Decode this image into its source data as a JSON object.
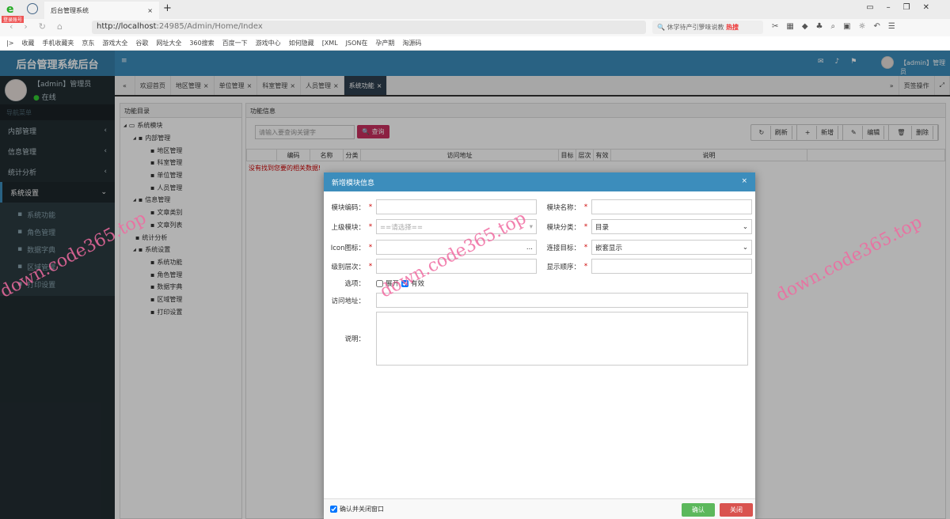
{
  "browser": {
    "tab_title": "后台管理系统",
    "badge": "登录账号",
    "url_host": "http://localhost",
    "url_rest": ":24985/Admin/Home/Index",
    "search_hint": "休学待产引箩味说教",
    "search_hot": "热搜",
    "bookmarks": [
      "收藏",
      "手机收藏夹",
      "京东",
      "游戏大全",
      "谷歌",
      "网址大全",
      "360搜索",
      "百度一下",
      "游戏中心",
      "如何隐藏",
      "[XML",
      "JSON在",
      "孕产期",
      "淘源码"
    ]
  },
  "app": {
    "logo": "后台管理系统后台",
    "header_user": "【admin】管理员",
    "user": {
      "name": "【admin】管理员",
      "status": "在线"
    },
    "nav_header": "导航菜单",
    "nav": [
      {
        "label": "内部管理"
      },
      {
        "label": "信息管理"
      },
      {
        "label": "统计分析"
      },
      {
        "label": "系统设置"
      }
    ],
    "sub_nav": [
      "系统功能",
      "角色管理",
      "数据字典",
      "区域管理",
      "打印设置"
    ],
    "tabs": [
      "欢迎首页",
      "地区管理",
      "单位管理",
      "科室管理",
      "人员管理",
      "系统功能"
    ],
    "tab_ops": "页签操作",
    "tree_title": "功能目录",
    "tree": [
      {
        "label": "系统模块",
        "lvl": 0
      },
      {
        "label": "内部管理",
        "lvl": 1
      },
      {
        "label": "地区管理",
        "lvl": 2
      },
      {
        "label": "科室管理",
        "lvl": 2
      },
      {
        "label": "单位管理",
        "lvl": 2
      },
      {
        "label": "人员管理",
        "lvl": 2
      },
      {
        "label": "信息管理",
        "lvl": 1
      },
      {
        "label": "文章类别",
        "lvl": 2
      },
      {
        "label": "文章列表",
        "lvl": 2
      },
      {
        "label": "统计分析",
        "lvl": 1
      },
      {
        "label": "系统设置",
        "lvl": 1
      },
      {
        "label": "系统功能",
        "lvl": 2
      },
      {
        "label": "角色管理",
        "lvl": 2
      },
      {
        "label": "数据字典",
        "lvl": 2
      },
      {
        "label": "区域管理",
        "lvl": 2
      },
      {
        "label": "打印设置",
        "lvl": 2
      }
    ],
    "panel_title": "功能信息",
    "search_placeholder": "请输入要查询关键字",
    "search_btn": "查询",
    "toolbar": [
      "刷新",
      "新增",
      "编辑",
      "删除"
    ],
    "columns": [
      "编码",
      "名称",
      "分类",
      "访问地址",
      "目标",
      "层次",
      "有效",
      "说明"
    ],
    "empty": "没有找到您要的相关数据!"
  },
  "modal": {
    "title": "新增模块信息",
    "code_label": "模块编码：",
    "name_label": "模块名称：",
    "parent_label": "上级模块：",
    "parent_placeholder": "==请选择==",
    "type_label": "模块分类：",
    "type_value": "目录",
    "icon_label": "Icon图标：",
    "icon_btn": "...",
    "target_label": "连接目标：",
    "target_value": "嵌套显示",
    "level_label": "级别层次：",
    "order_label": "显示顺序：",
    "options_label": "选项：",
    "opt_expand": "展开",
    "opt_expand_checked": false,
    "opt_valid": "有效",
    "opt_valid_checked": true,
    "url_label": "访问地址：",
    "desc_label": "说明：",
    "confirm_close": "确认并关闭窗口",
    "confirm_close_checked": true,
    "ok": "确认",
    "close": "关闭"
  },
  "watermark": "down.code365.top",
  "colors": {
    "primary": "#3c8dbc",
    "sidebar": "#222d32",
    "ok": "#5cb85c",
    "close": "#d9534f",
    "search_btn": "#c9305f"
  }
}
